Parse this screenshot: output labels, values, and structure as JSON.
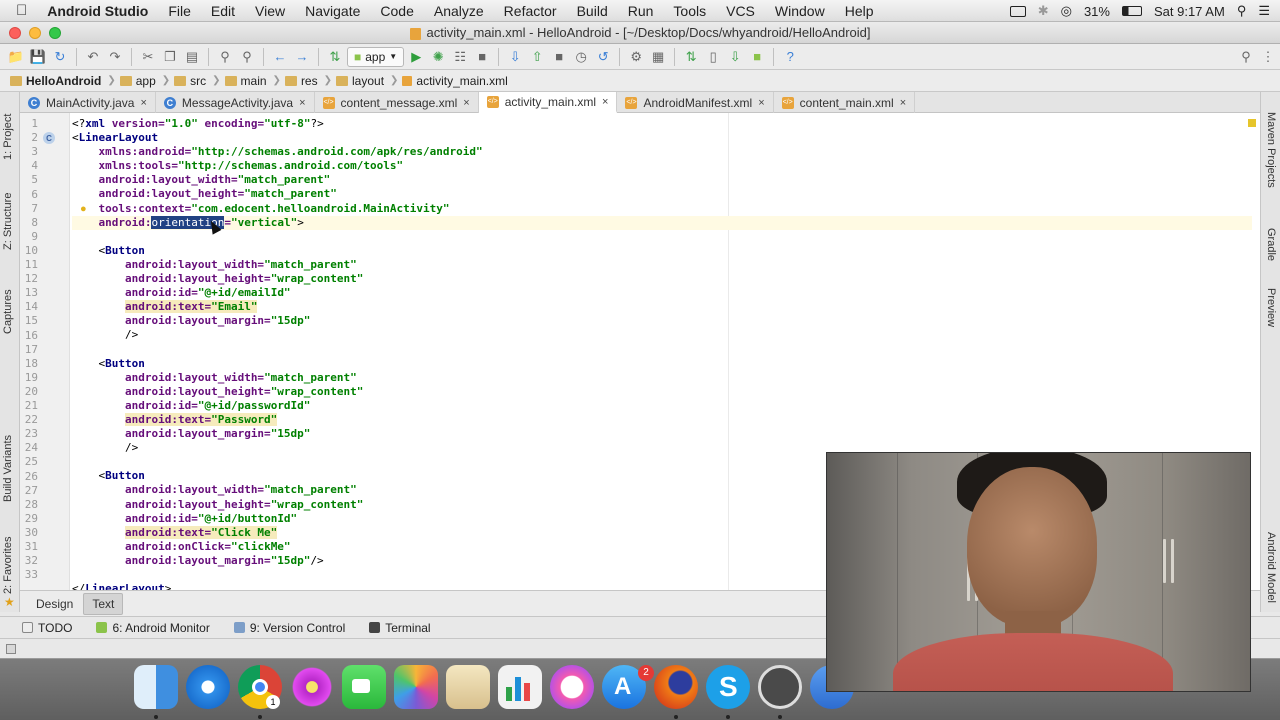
{
  "menubar": {
    "apple": "",
    "app": "Android Studio",
    "items": [
      "File",
      "Edit",
      "View",
      "Navigate",
      "Code",
      "Analyze",
      "Refactor",
      "Build",
      "Run",
      "Tools",
      "VCS",
      "Window",
      "Help"
    ],
    "battery": "31%",
    "clock": "Sat 9:17 AM"
  },
  "window": {
    "title": "activity_main.xml - HelloAndroid - [~/Desktop/Docs/whyandroid/HelloAndroid]"
  },
  "toolbar": {
    "run_config": "app"
  },
  "breadcrumb": [
    "HelloAndroid",
    "app",
    "src",
    "main",
    "res",
    "layout",
    "activity_main.xml"
  ],
  "tabs": [
    {
      "label": "MainActivity.java",
      "kind": "java",
      "active": false
    },
    {
      "label": "MessageActivity.java",
      "kind": "java",
      "active": false
    },
    {
      "label": "content_message.xml",
      "kind": "xml",
      "active": false
    },
    {
      "label": "activity_main.xml",
      "kind": "xml",
      "active": true
    },
    {
      "label": "AndroidManifest.xml",
      "kind": "xml",
      "active": false
    },
    {
      "label": "content_main.xml",
      "kind": "xml",
      "active": false
    }
  ],
  "left_tools": [
    "1: Project",
    "Z: Structure",
    "Captures",
    "Build Variants",
    "2: Favorites"
  ],
  "right_tools": [
    "Maven Projects",
    "Gradle",
    "Preview",
    "Android Model"
  ],
  "code": {
    "line_numbers": [
      "1",
      "2",
      "3",
      "4",
      "5",
      "6",
      "7",
      "8",
      "9",
      "10",
      "11",
      "12",
      "13",
      "14",
      "15",
      "16",
      "17",
      "18",
      "19",
      "20",
      "21",
      "22",
      "23",
      "24",
      "25",
      "26",
      "27",
      "28",
      "29",
      "30",
      "31",
      "32",
      "33"
    ],
    "lines": [
      [
        [
          "plain",
          "<?"
        ],
        [
          "tag",
          "xml "
        ],
        [
          "attr",
          "version="
        ],
        [
          "val",
          "\"1.0\""
        ],
        [
          "attr",
          " encoding="
        ],
        [
          "val",
          "\"utf-8\""
        ],
        [
          "plain",
          "?>"
        ]
      ],
      [
        [
          "plain",
          "<"
        ],
        [
          "tag",
          "LinearLayout"
        ]
      ],
      [
        [
          "plain",
          "    "
        ],
        [
          "ns",
          "xmlns:android="
        ],
        [
          "val",
          "\"http://schemas.android.com/apk/res/android\""
        ]
      ],
      [
        [
          "plain",
          "    "
        ],
        [
          "ns",
          "xmlns:tools="
        ],
        [
          "val",
          "\"http://schemas.android.com/tools\""
        ]
      ],
      [
        [
          "plain",
          "    "
        ],
        [
          "attr",
          "android:layout_width="
        ],
        [
          "val",
          "\"match_parent\""
        ]
      ],
      [
        [
          "plain",
          "    "
        ],
        [
          "attr",
          "android:layout_height="
        ],
        [
          "val",
          "\"match_parent\""
        ]
      ],
      [
        [
          "plain",
          "    "
        ],
        [
          "attr",
          "tools:context="
        ],
        [
          "val",
          "\"com.edocent.helloandroid.MainActivity\""
        ]
      ],
      [
        [
          "plain",
          "    "
        ],
        [
          "attr",
          "android:"
        ],
        [
          "sel",
          "orientation"
        ],
        [
          "attr",
          "="
        ],
        [
          "val",
          "\"vertical\""
        ],
        [
          "plain",
          ">"
        ]
      ],
      [
        [
          "plain",
          ""
        ]
      ],
      [
        [
          "plain",
          "    <"
        ],
        [
          "tag",
          "Button"
        ]
      ],
      [
        [
          "plain",
          "        "
        ],
        [
          "attr",
          "android:layout_width="
        ],
        [
          "val",
          "\"match_parent\""
        ]
      ],
      [
        [
          "plain",
          "        "
        ],
        [
          "attr",
          "android:layout_height="
        ],
        [
          "val",
          "\"wrap_content\""
        ]
      ],
      [
        [
          "plain",
          "        "
        ],
        [
          "attr",
          "android:id="
        ],
        [
          "val",
          "\"@+id/emailId\""
        ]
      ],
      [
        [
          "plain",
          "        "
        ],
        [
          "hlattr",
          "android:text="
        ],
        [
          "hlval",
          "\"Email\""
        ]
      ],
      [
        [
          "plain",
          "        "
        ],
        [
          "attr",
          "android:layout_margin="
        ],
        [
          "val",
          "\"15dp\""
        ]
      ],
      [
        [
          "plain",
          "        />"
        ]
      ],
      [
        [
          "plain",
          ""
        ]
      ],
      [
        [
          "plain",
          "    <"
        ],
        [
          "tag",
          "Button"
        ]
      ],
      [
        [
          "plain",
          "        "
        ],
        [
          "attr",
          "android:layout_width="
        ],
        [
          "val",
          "\"match_parent\""
        ]
      ],
      [
        [
          "plain",
          "        "
        ],
        [
          "attr",
          "android:layout_height="
        ],
        [
          "val",
          "\"wrap_content\""
        ]
      ],
      [
        [
          "plain",
          "        "
        ],
        [
          "attr",
          "android:id="
        ],
        [
          "val",
          "\"@+id/passwordId\""
        ]
      ],
      [
        [
          "plain",
          "        "
        ],
        [
          "hlattr",
          "android:text="
        ],
        [
          "hlval",
          "\"Password\""
        ]
      ],
      [
        [
          "plain",
          "        "
        ],
        [
          "attr",
          "android:layout_margin="
        ],
        [
          "val",
          "\"15dp\""
        ]
      ],
      [
        [
          "plain",
          "        />"
        ]
      ],
      [
        [
          "plain",
          ""
        ]
      ],
      [
        [
          "plain",
          "    <"
        ],
        [
          "tag",
          "Button"
        ]
      ],
      [
        [
          "plain",
          "        "
        ],
        [
          "attr",
          "android:layout_width="
        ],
        [
          "val",
          "\"match_parent\""
        ]
      ],
      [
        [
          "plain",
          "        "
        ],
        [
          "attr",
          "android:layout_height="
        ],
        [
          "val",
          "\"wrap_content\""
        ]
      ],
      [
        [
          "plain",
          "        "
        ],
        [
          "attr",
          "android:id="
        ],
        [
          "val",
          "\"@+id/buttonId\""
        ]
      ],
      [
        [
          "plain",
          "        "
        ],
        [
          "hlattr",
          "android:text="
        ],
        [
          "hlval",
          "\"Click Me\""
        ]
      ],
      [
        [
          "plain",
          "        "
        ],
        [
          "attr",
          "android:onClick="
        ],
        [
          "val",
          "\"clickMe\""
        ]
      ],
      [
        [
          "plain",
          "        "
        ],
        [
          "attr",
          "android:layout_margin="
        ],
        [
          "val",
          "\"15dp\""
        ],
        [
          "plain",
          "/>"
        ]
      ],
      [
        [
          "plain",
          ""
        ]
      ],
      [
        [
          "plain",
          "</"
        ],
        [
          "tag",
          "LinearLayout"
        ],
        [
          "plain",
          ">"
        ]
      ]
    ],
    "current_line": 8
  },
  "editor_tabs": [
    {
      "label": "Design",
      "active": false
    },
    {
      "label": "Text",
      "active": true
    }
  ],
  "tool_windows": [
    {
      "label": "TODO",
      "icon": "todo-icon"
    },
    {
      "label": "6: Android Monitor",
      "icon": "android-icon"
    },
    {
      "label": "9: Version Control",
      "icon": "vcs-icon"
    },
    {
      "label": "Terminal",
      "icon": "terminal-icon"
    }
  ],
  "dock_badges": {
    "appstore": "2",
    "chrome": "1"
  },
  "colors": {
    "accent": "#3f7fd1",
    "selection": "#214283",
    "current_line": "#fffae3",
    "warn_mark": "#e6c52b"
  }
}
